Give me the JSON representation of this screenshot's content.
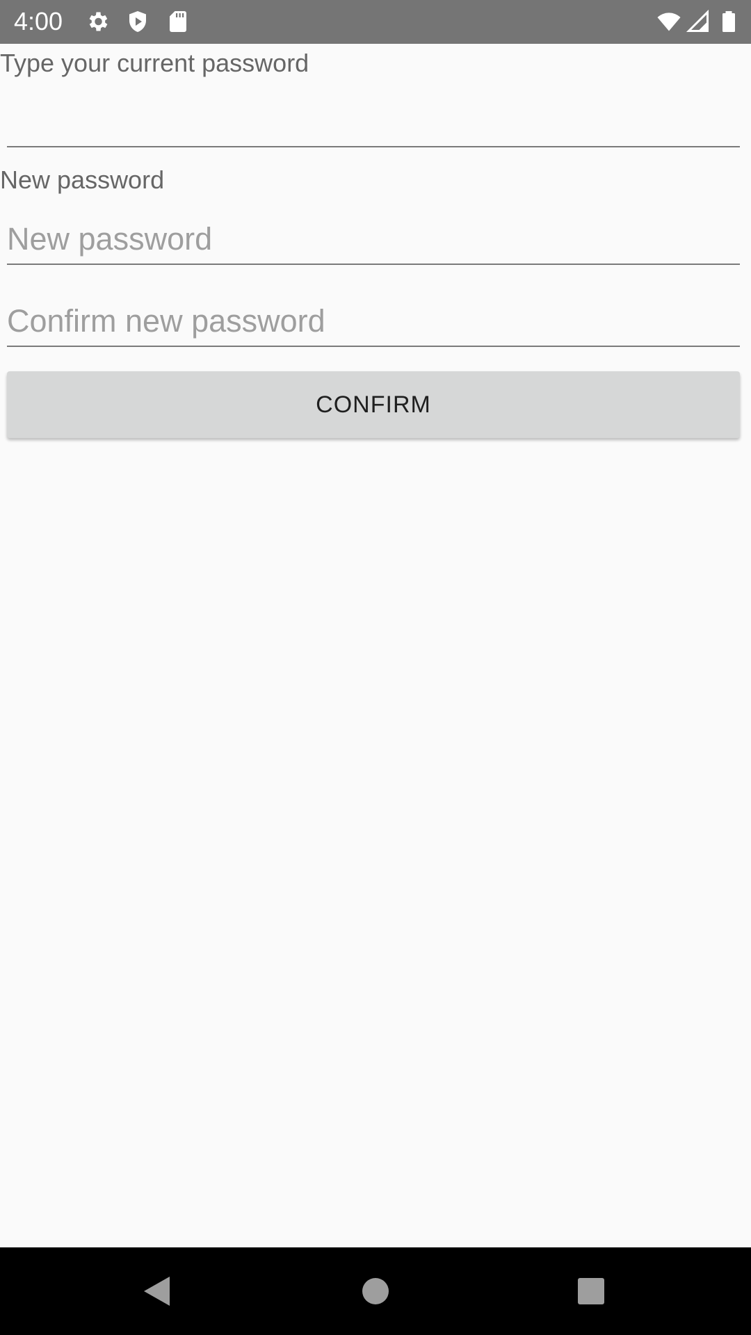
{
  "status_bar": {
    "time": "4:00",
    "icons": [
      "gear-icon",
      "shield-icon",
      "sd-card-icon",
      "wifi-icon",
      "signal-icon",
      "battery-icon"
    ]
  },
  "form": {
    "current_password_label": "Type your current password",
    "current_password_value": "",
    "new_password_label": "New password",
    "new_password_placeholder": "New password",
    "confirm_password_placeholder": "Confirm new password",
    "confirm_button_label": "CONFIRM"
  },
  "nav_bar": {
    "icons": [
      "back-icon",
      "home-icon",
      "recents-icon"
    ]
  },
  "colors": {
    "status_bar": "#757575",
    "background": "#fafafa",
    "button": "#d6d7d7",
    "nav_bar": "#000000"
  }
}
